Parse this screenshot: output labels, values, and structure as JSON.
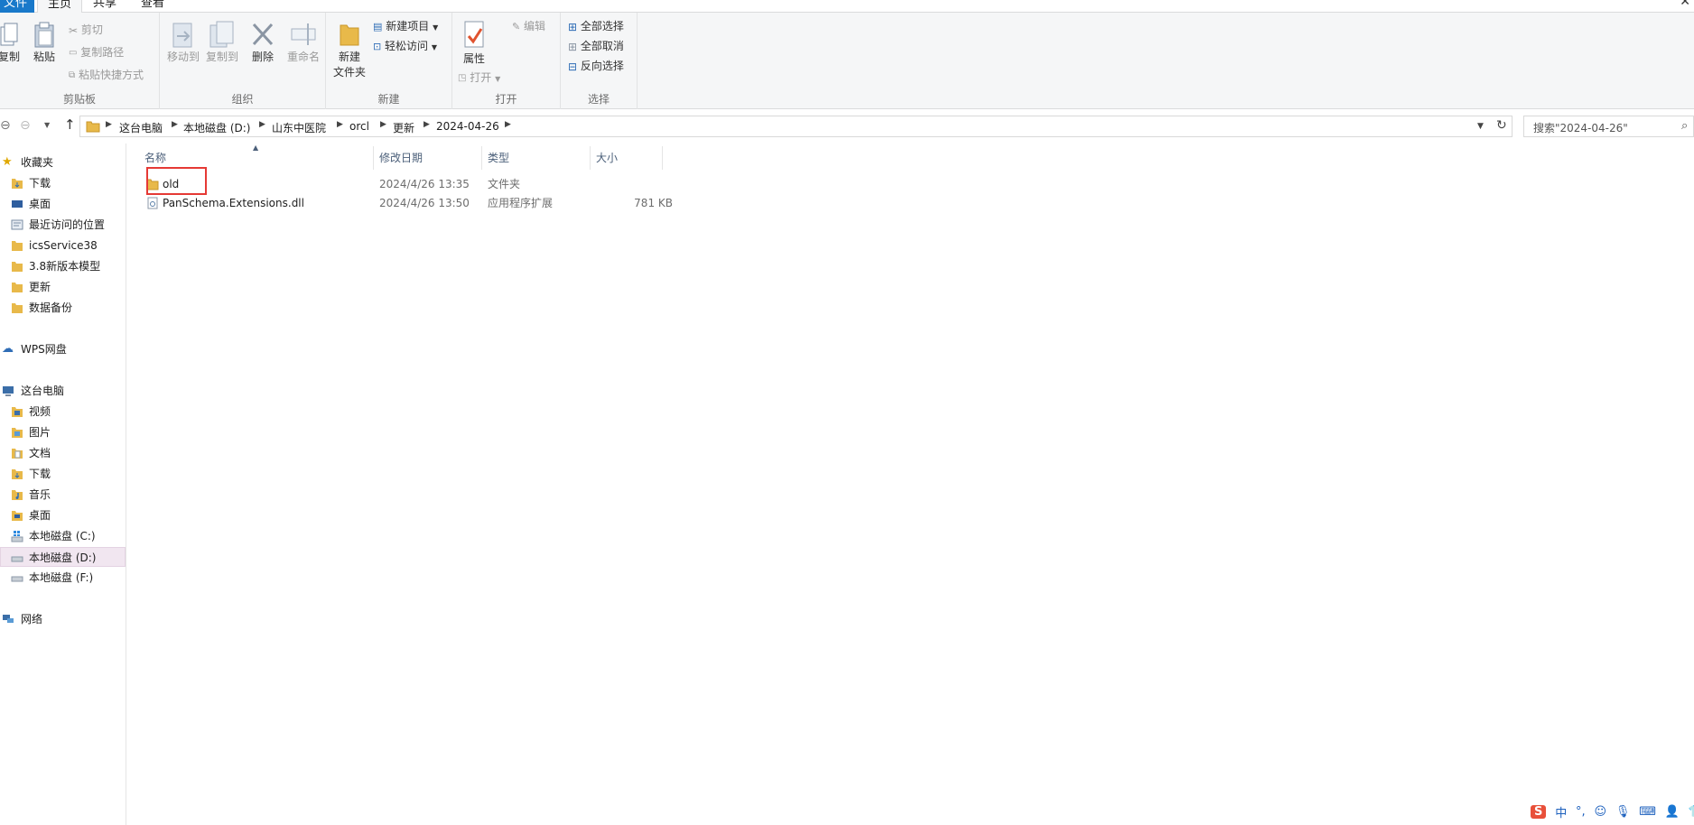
{
  "ribbon_tabs": [
    "文件",
    "主页",
    "共享",
    "查看"
  ],
  "ribbon": {
    "clipboard": {
      "copy": "复制",
      "paste": "粘贴",
      "cut": "剪切",
      "copy_path": "复制路径",
      "paste_shortcut": "粘贴快捷方式",
      "label": "剪贴板"
    },
    "organize": {
      "move_to": "移动到",
      "copy_to": "复制到",
      "delete": "删除",
      "rename": "重命名",
      "label": "组织"
    },
    "new": {
      "new_folder_line1": "新建",
      "new_folder_line2": "文件夹",
      "new_item": "新建项目",
      "easy_access": "轻松访问",
      "label": "新建"
    },
    "open": {
      "properties": "属性",
      "open": "打开",
      "edit": "编辑",
      "label": "打开"
    },
    "select": {
      "select_all": "全部选择",
      "select_none": "全部取消",
      "invert": "反向选择",
      "label": "选择"
    }
  },
  "address": {
    "crumbs": [
      "这台电脑",
      "本地磁盘 (D:)",
      "山东中医院",
      "orcl",
      "更新",
      "2024-04-26"
    ],
    "search_placeholder": "搜索\"2024-04-26\""
  },
  "nav": {
    "favorites_header": "收藏夹",
    "favorites": [
      "下载",
      "桌面",
      "最近访问的位置",
      "icsService38",
      "3.8新版本模型",
      "更新",
      "数据备份"
    ],
    "wps": "WPS网盘",
    "this_pc_header": "这台电脑",
    "this_pc": [
      "视频",
      "图片",
      "文档",
      "下载",
      "音乐",
      "桌面",
      "本地磁盘 (C:)",
      "本地磁盘 (D:)",
      "本地磁盘 (F:)"
    ],
    "network": "网络"
  },
  "columns": [
    "名称",
    "修改日期",
    "类型",
    "大小"
  ],
  "files": [
    {
      "name": "old",
      "modified": "2024/4/26 13:35",
      "type": "文件夹",
      "size": ""
    },
    {
      "name": "PanSchema.Extensions.dll",
      "modified": "2024/4/26 13:50",
      "type": "应用程序扩展",
      "size": "781 KB"
    }
  ],
  "ime": {
    "logo": "S",
    "mode": "中"
  },
  "colors": {
    "file_tab": "#1979ca",
    "highlight": "#e53935",
    "selected_nav": "#f1e6f0",
    "folder": "#e8b94a"
  }
}
